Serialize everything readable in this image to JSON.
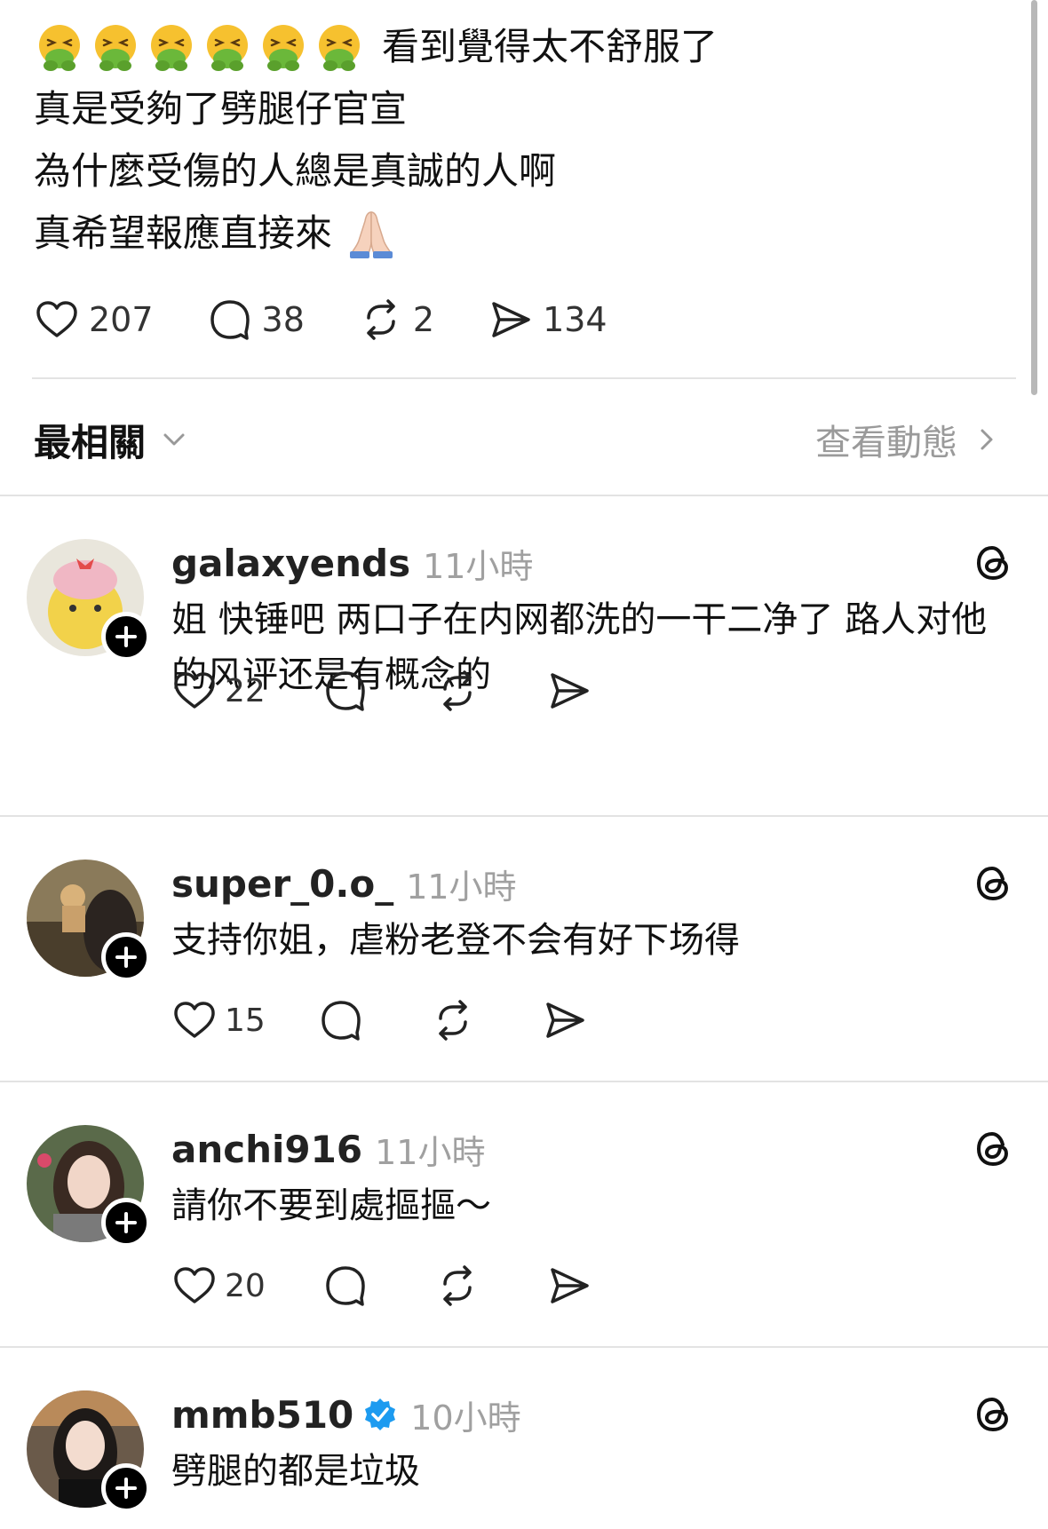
{
  "post": {
    "reaction_emoji": "nauseated-face",
    "reaction_emoji_count": 6,
    "line1": "看到覺得太不舒服了",
    "line2": "真是受夠了劈腿仔官宣",
    "line3": "為什麼受傷的人總是真誠的人啊",
    "line4": "真希望報應直接來",
    "line4_emoji": "folded-hands",
    "likes": "207",
    "replies": "38",
    "reposts": "2",
    "shares": "134"
  },
  "sort": {
    "label": "最相關",
    "view_activity": "查看動態"
  },
  "comments": [
    {
      "username": "galaxyends",
      "time": "11小時",
      "verified": false,
      "text": "姐 快锤吧 两口子在内网都洗的一干二净了 路人对他的风评还是有概念的",
      "likes": "22"
    },
    {
      "username": "super_0.o_",
      "time": "11小時",
      "verified": false,
      "text": "支持你姐，虐粉老登不会有好下场得",
      "likes": "15"
    },
    {
      "username": "anchi916",
      "time": "11小時",
      "verified": false,
      "text": "請你不要到處摳摳～",
      "likes": "20"
    },
    {
      "username": "mmb510",
      "time": "10小時",
      "verified": true,
      "text": "劈腿的都是垃圾",
      "likes": ""
    }
  ],
  "colors": {
    "verified_blue": "#1d9bf0",
    "muted_text": "#a0a0a0",
    "divider": "#e3e3e3"
  }
}
